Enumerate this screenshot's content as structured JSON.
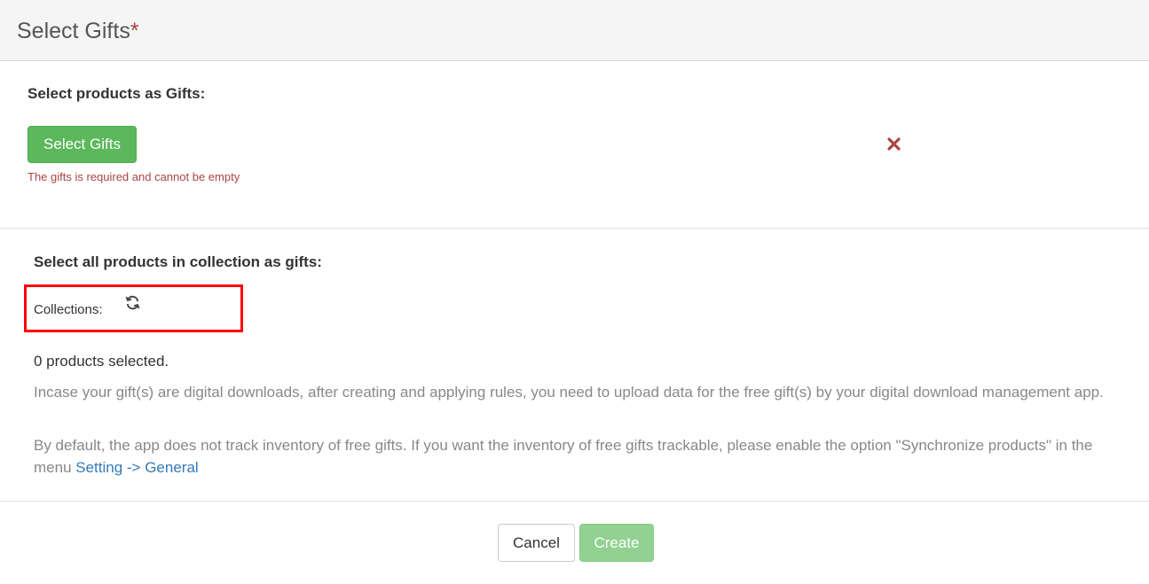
{
  "modal": {
    "title": "Select Gifts",
    "required_marker": "*"
  },
  "gifts_section": {
    "heading": "Select products as Gifts:",
    "select_button_label": "Select Gifts",
    "error_message": "The gifts is required and cannot be empty",
    "remove_icon": "close-x-icon"
  },
  "collection_section": {
    "heading": "Select all products in collection as gifts:",
    "collections_label": "Collections:",
    "refresh_icon": "refresh-icon",
    "products_selected": "0 products selected.",
    "digital_note": "Incase your gift(s) are digital downloads, after creating and applying rules, you need to upload data for the free gift(s) by your digital download management app.",
    "inventory_note_prefix": "By default, the app does not track inventory of free gifts. If you want the inventory of free gifts trackable, please enable the option \"Synchronize products\" in the menu ",
    "inventory_link": "Setting -> General"
  },
  "footer": {
    "cancel_label": "Cancel",
    "create_label": "Create"
  },
  "colors": {
    "primary_green": "#5cb85c",
    "disabled_green": "#91d191",
    "error_red": "#a94442",
    "highlight_red": "#ff0000",
    "link_blue": "#337ab7"
  }
}
